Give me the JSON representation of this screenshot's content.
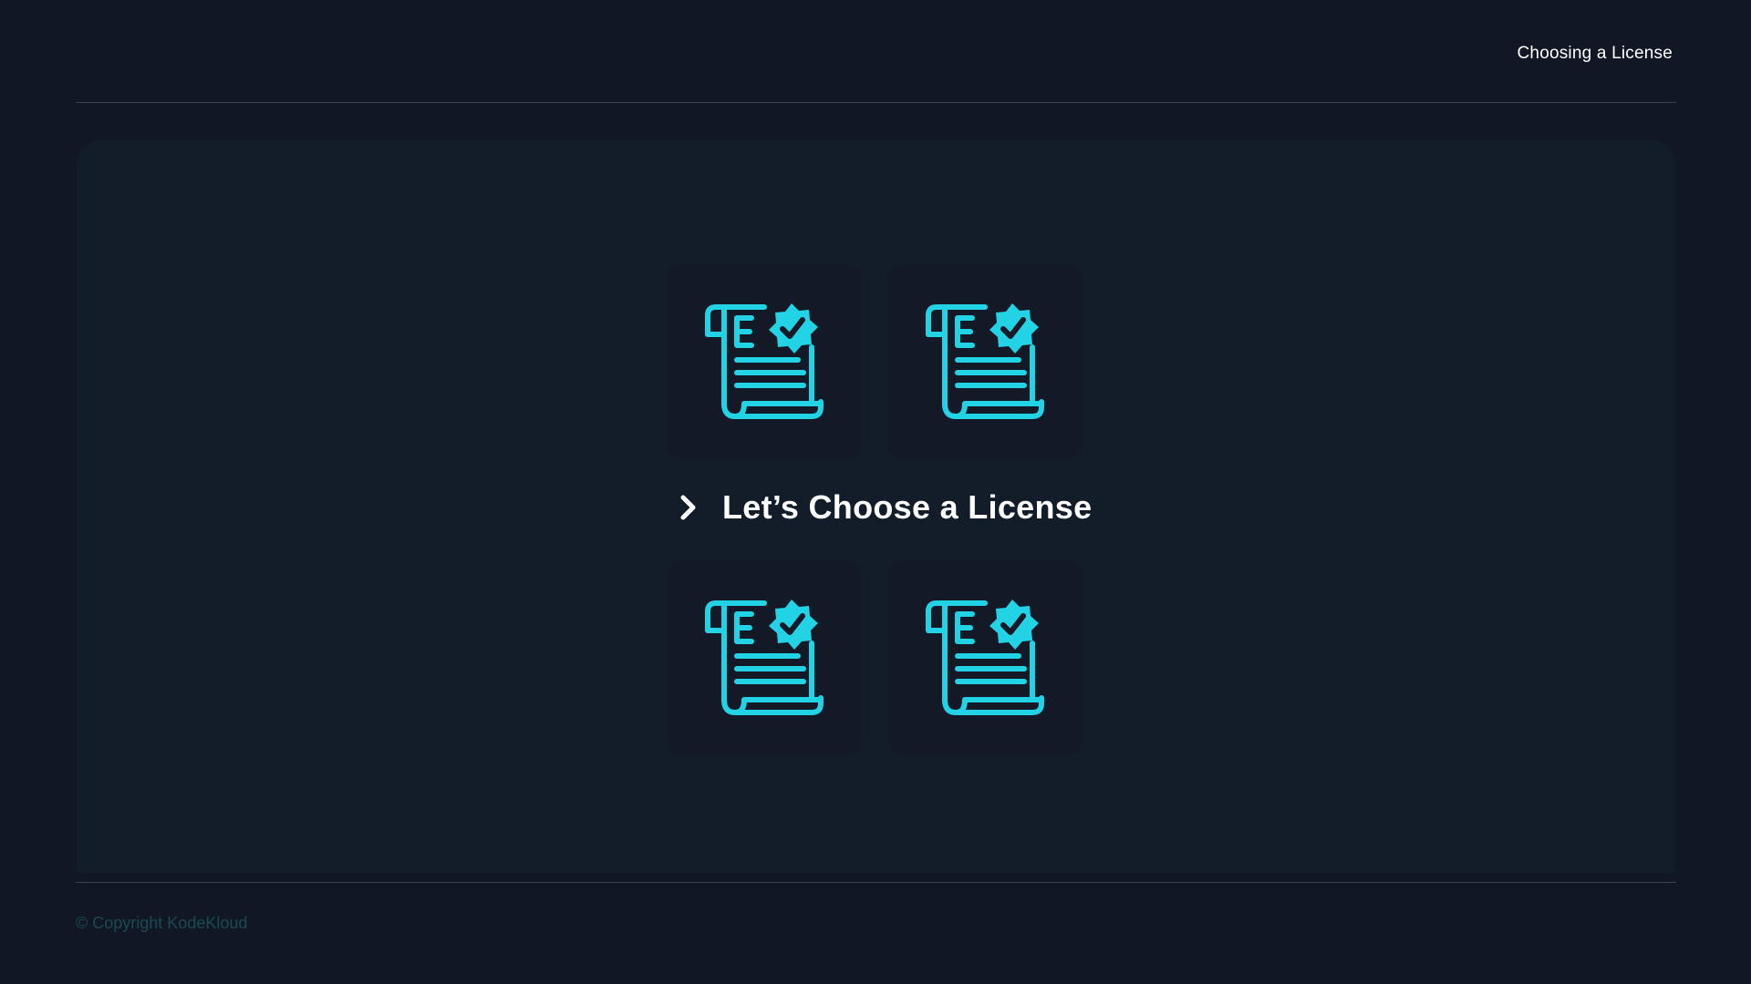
{
  "header": {
    "title": "Choosing a License"
  },
  "main": {
    "heading": "Let’s Choose a License",
    "cards": [
      {
        "icon": "license-certificate-icon"
      },
      {
        "icon": "license-certificate-icon"
      },
      {
        "icon": "license-certificate-icon"
      },
      {
        "icon": "license-certificate-icon"
      }
    ]
  },
  "footer": {
    "copyright": "© Copyright KodeKloud"
  },
  "colors": {
    "background": "#121725",
    "panel": "#121d29",
    "card": "#131927",
    "accent": "#22d3e6",
    "text": "#ffffff",
    "footer_text": "#1c4a52"
  }
}
